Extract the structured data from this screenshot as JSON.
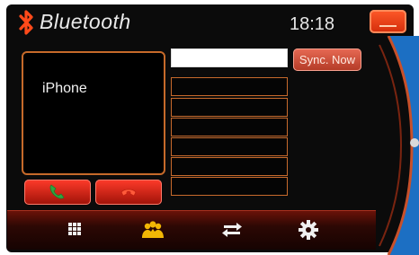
{
  "header": {
    "title": "Bluetooth",
    "time": "18:18",
    "bluetooth_icon": "bluetooth-icon",
    "minimize_icon": "minimize-icon"
  },
  "device": {
    "name": "iPhone"
  },
  "call_buttons": {
    "answer_icon": "phone-answer-icon",
    "hangup_icon": "phone-hangup-icon"
  },
  "sync": {
    "label": "Sync. Now"
  },
  "contact_list": {
    "rows": [
      "",
      "",
      "",
      "",
      "",
      "",
      "",
      ""
    ]
  },
  "tabs": [
    {
      "icon": "keypad-icon"
    },
    {
      "icon": "contacts-icon"
    },
    {
      "icon": "transfer-icon"
    },
    {
      "icon": "settings-icon"
    }
  ],
  "colors": {
    "accent": "#c66a2a",
    "button_red": "#e0301c",
    "answer_green": "#2ea640",
    "side_blue": "#1b6fc4",
    "contacts_yellow": "#f2b705"
  }
}
